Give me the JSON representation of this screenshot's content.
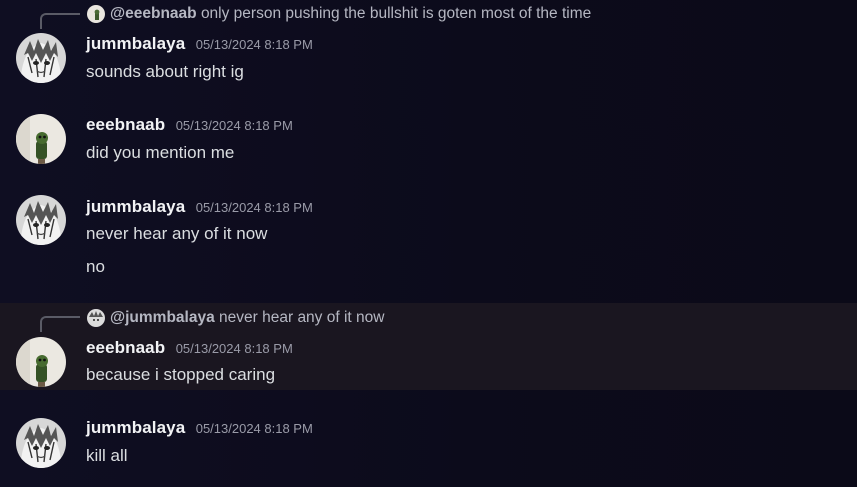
{
  "messages": [
    {
      "reply": {
        "mention": "@eeebnaab",
        "text": "only person pushing the bullshit is goten most of the time"
      },
      "author": "jummbalaya",
      "timestamp": "05/13/2024 8:18 PM",
      "lines": [
        "sounds about right ig"
      ]
    },
    {
      "author": "eeebnaab",
      "timestamp": "05/13/2024 8:18 PM",
      "lines": [
        "did you mention me"
      ]
    },
    {
      "author": "jummbalaya",
      "timestamp": "05/13/2024 8:18 PM",
      "lines": [
        "never hear any of it now",
        "no"
      ]
    },
    {
      "reply": {
        "mention": "@jummbalaya",
        "text": "never hear any of it now"
      },
      "author": "eeebnaab",
      "timestamp": "05/13/2024 8:18 PM",
      "lines": [
        "because i stopped caring"
      ],
      "highlighted": true
    },
    {
      "author": "jummbalaya",
      "timestamp": "05/13/2024 8:18 PM",
      "lines": [
        "kill all"
      ]
    }
  ],
  "colors": {
    "background": "#0d0c1c",
    "highlight": "#1a1620",
    "author": "#f2f3f5",
    "text": "#dbdee1",
    "timestamp": "#9a9ba8"
  }
}
